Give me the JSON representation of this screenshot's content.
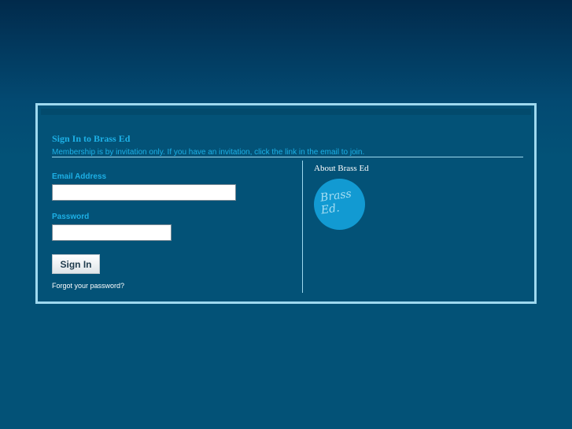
{
  "signin": {
    "title": "Sign In to Brass Ed",
    "subtitle": "Membership is by invitation only. If you have an invitation, click the link in the email to join.",
    "email_label": "Email Address",
    "email_value": "",
    "password_label": "Password",
    "password_value": "",
    "submit_label": "Sign In",
    "forgot_link": "Forgot your password?"
  },
  "about": {
    "title": "About Brass Ed",
    "logo_line1": "Brass",
    "logo_line2": "Ed."
  },
  "colors": {
    "background": "#035277",
    "accent": "#1db0e6",
    "frame": "#9fd9ef",
    "logo": "#129ad2"
  }
}
